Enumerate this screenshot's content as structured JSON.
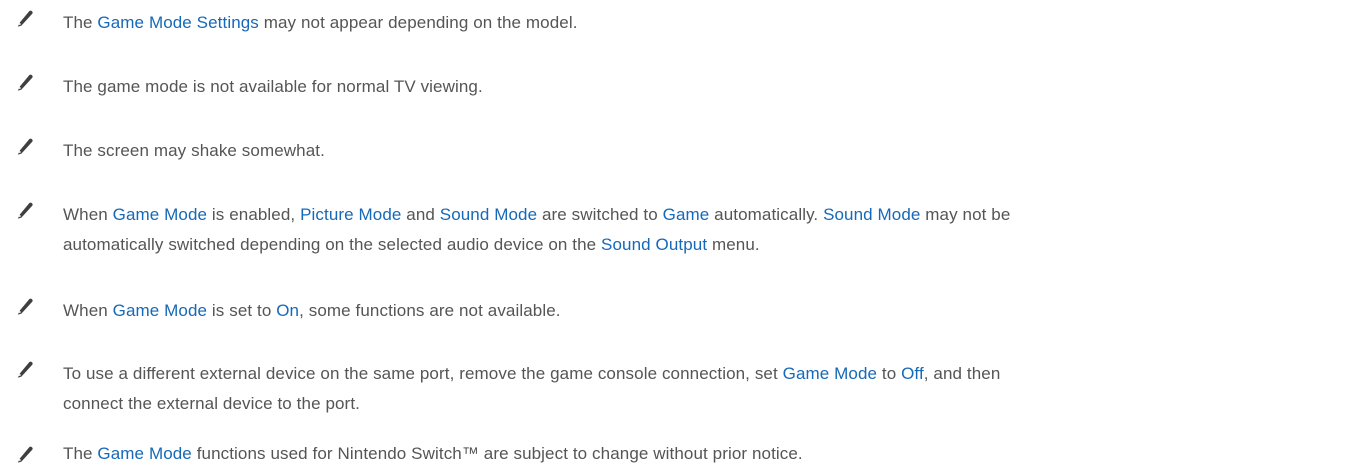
{
  "icon": "pencil-icon",
  "accent_color": "#1668b8",
  "notes": [
    {
      "segments": [
        {
          "t": "The "
        },
        {
          "t": "Game Mode Settings",
          "hl": true
        },
        {
          "t": " may not appear depending on the model."
        }
      ]
    },
    {
      "segments": [
        {
          "t": "The game mode is not available for normal TV viewing."
        }
      ]
    },
    {
      "segments": [
        {
          "t": "The screen may shake somewhat."
        }
      ]
    },
    {
      "segments": [
        {
          "t": "When "
        },
        {
          "t": "Game Mode",
          "hl": true
        },
        {
          "t": " is enabled, "
        },
        {
          "t": "Picture Mode",
          "hl": true
        },
        {
          "t": " and "
        },
        {
          "t": "Sound Mode",
          "hl": true
        },
        {
          "t": " are switched to "
        },
        {
          "t": "Game",
          "hl": true
        },
        {
          "t": " automatically. "
        },
        {
          "t": "Sound Mode",
          "hl": true
        },
        {
          "t": " may not be"
        },
        {
          "br": true
        },
        {
          "t": "automatically switched depending on the selected audio device on the "
        },
        {
          "t": "Sound Output",
          "hl": true
        },
        {
          "t": " menu."
        }
      ]
    },
    {
      "segments": [
        {
          "t": "When "
        },
        {
          "t": "Game Mode",
          "hl": true
        },
        {
          "t": " is set to "
        },
        {
          "t": "On",
          "hl": true
        },
        {
          "t": ", some functions are not available."
        }
      ]
    },
    {
      "segments": [
        {
          "t": "To use a different external device on the same port, remove the game console connection, set "
        },
        {
          "t": "Game Mode",
          "hl": true
        },
        {
          "t": " to "
        },
        {
          "t": "Off",
          "hl": true
        },
        {
          "t": ", and then"
        },
        {
          "br": true
        },
        {
          "t": "connect the external device to the port."
        }
      ]
    },
    {
      "segments": [
        {
          "t": "The "
        },
        {
          "t": "Game Mode",
          "hl": true
        },
        {
          "t": " functions used for Nintendo Switch™ are subject to change without prior notice."
        }
      ]
    }
  ]
}
